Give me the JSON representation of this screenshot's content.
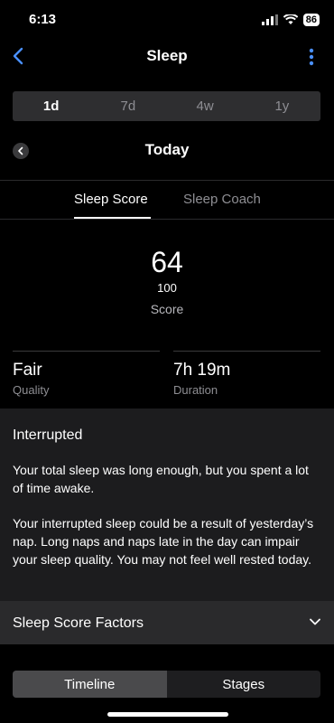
{
  "status_bar": {
    "time": "6:13",
    "battery": "86"
  },
  "nav": {
    "title": "Sleep"
  },
  "range_tabs": [
    {
      "label": "1d",
      "active": true
    },
    {
      "label": "7d",
      "active": false
    },
    {
      "label": "4w",
      "active": false
    },
    {
      "label": "1y",
      "active": false
    }
  ],
  "date": {
    "title": "Today"
  },
  "tabs": {
    "score": "Sleep Score",
    "coach": "Sleep Coach"
  },
  "score": {
    "value": "64",
    "max": "100",
    "label": "Score"
  },
  "stats": {
    "quality": {
      "value": "Fair",
      "label": "Quality"
    },
    "duration": {
      "value": "7h 19m",
      "label": "Duration"
    }
  },
  "insight": {
    "title": "Interrupted",
    "paragraph1": "Your total sleep was long enough, but you spent a lot of time awake.",
    "paragraph2": "Your interrupted sleep could be a result of yesterday’s nap. Long naps and naps late in the day can impair your sleep quality. You may not feel well rested today."
  },
  "factors": {
    "label": "Sleep Score Factors"
  },
  "view_toggle": {
    "timeline": "Timeline",
    "stages": "Stages"
  },
  "colors": {
    "accent": "#4a90ff",
    "background": "#000000",
    "card": "#1c1c1e"
  }
}
